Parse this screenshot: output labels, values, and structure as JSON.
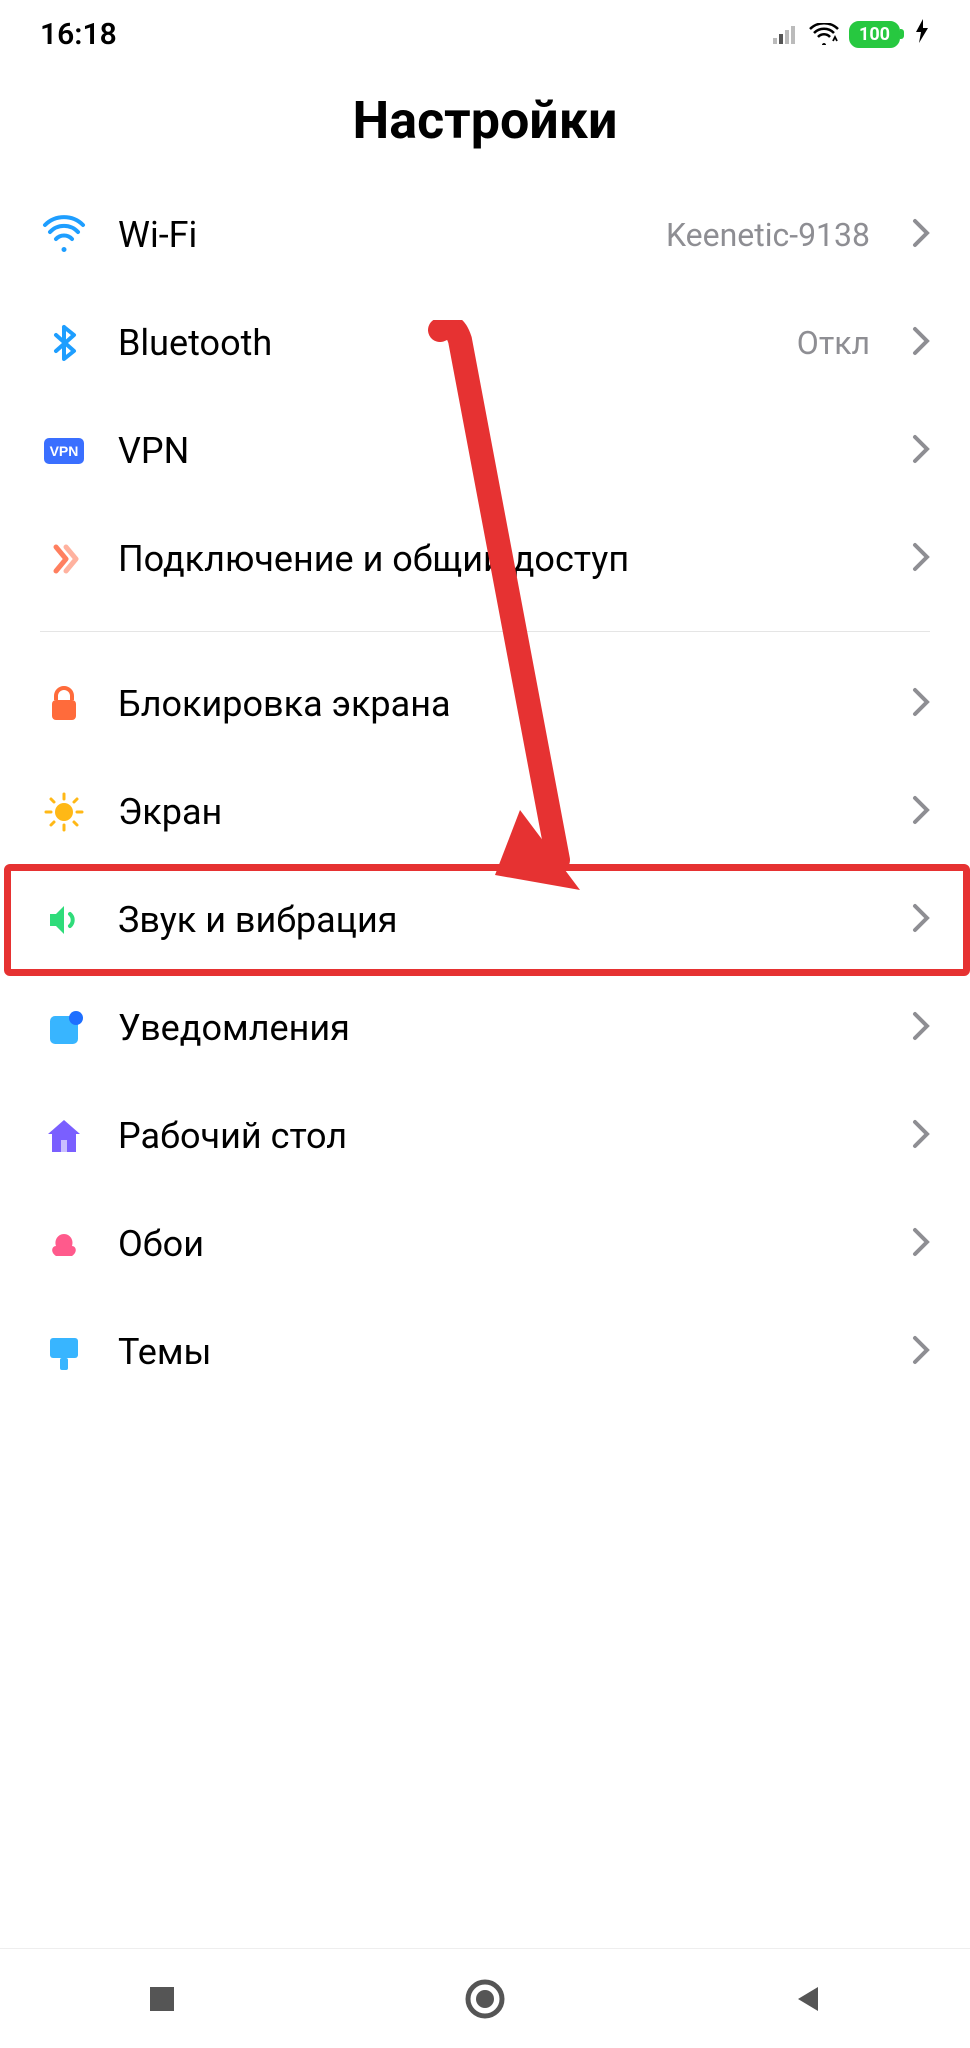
{
  "status": {
    "time": "16:18",
    "battery_percent": "100"
  },
  "page_title": "Настройки",
  "sections": [
    {
      "items": [
        {
          "id": "wifi",
          "label": "Wi-Fi",
          "value": "Keenetic-9138",
          "icon": "wifi-icon"
        },
        {
          "id": "bluetooth",
          "label": "Bluetooth",
          "value": "Откл",
          "icon": "bluetooth-icon"
        },
        {
          "id": "vpn",
          "label": "VPN",
          "value": "",
          "icon": "vpn-icon"
        },
        {
          "id": "sharing",
          "label": "Подключение и общий доступ",
          "value": "",
          "icon": "sharing-icon"
        }
      ]
    },
    {
      "items": [
        {
          "id": "lockscreen",
          "label": "Блокировка экрана",
          "value": "",
          "icon": "lock-icon"
        },
        {
          "id": "display",
          "label": "Экран",
          "value": "",
          "icon": "brightness-icon"
        },
        {
          "id": "sound",
          "label": "Звук и вибрация",
          "value": "",
          "icon": "sound-icon",
          "highlighted": true
        },
        {
          "id": "notifications",
          "label": "Уведомления",
          "value": "",
          "icon": "notifications-icon"
        },
        {
          "id": "home",
          "label": "Рабочий стол",
          "value": "",
          "icon": "home-icon"
        },
        {
          "id": "wallpaper",
          "label": "Обои",
          "value": "",
          "icon": "wallpaper-icon"
        },
        {
          "id": "themes",
          "label": "Темы",
          "value": "",
          "icon": "themes-icon"
        }
      ]
    }
  ],
  "annotation": {
    "arrow_color": "#e63232",
    "highlight_color": "#e63232"
  }
}
